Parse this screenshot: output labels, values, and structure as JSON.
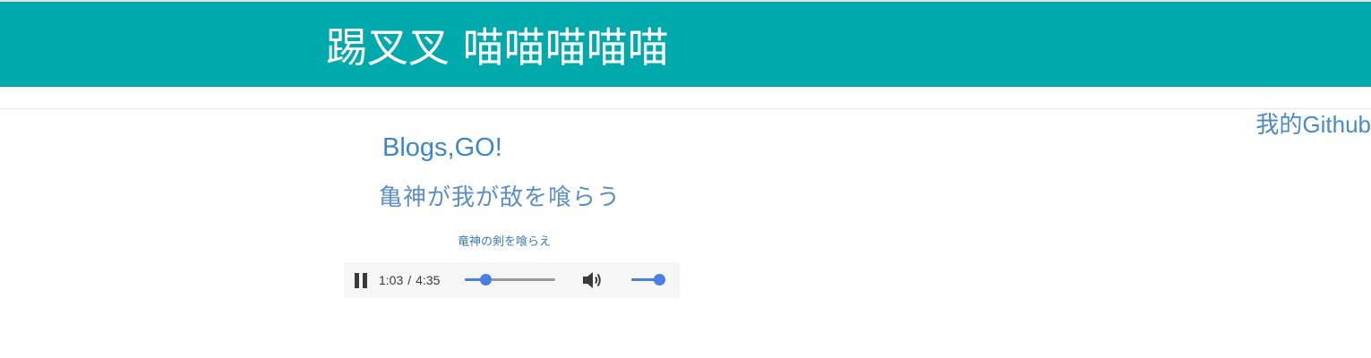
{
  "header": {
    "site_title": "踢叉叉 喵喵喵喵喵",
    "background_color": "#00a9ab"
  },
  "github_link": {
    "label": "我的Github"
  },
  "blog": {
    "title": "Blogs,GO!"
  },
  "song": {
    "title": "亀神が我が敌を喰らう",
    "subtitle": "竜神の剣を喰らえ"
  },
  "audio_player": {
    "state_icon": "pause-icon",
    "current_time": "1:03",
    "duration": "4:35",
    "progress_fraction": 0.229,
    "volume_fraction": 1.0,
    "volume_icon": "volume-icon",
    "accent_color": "#4a7fe6"
  }
}
